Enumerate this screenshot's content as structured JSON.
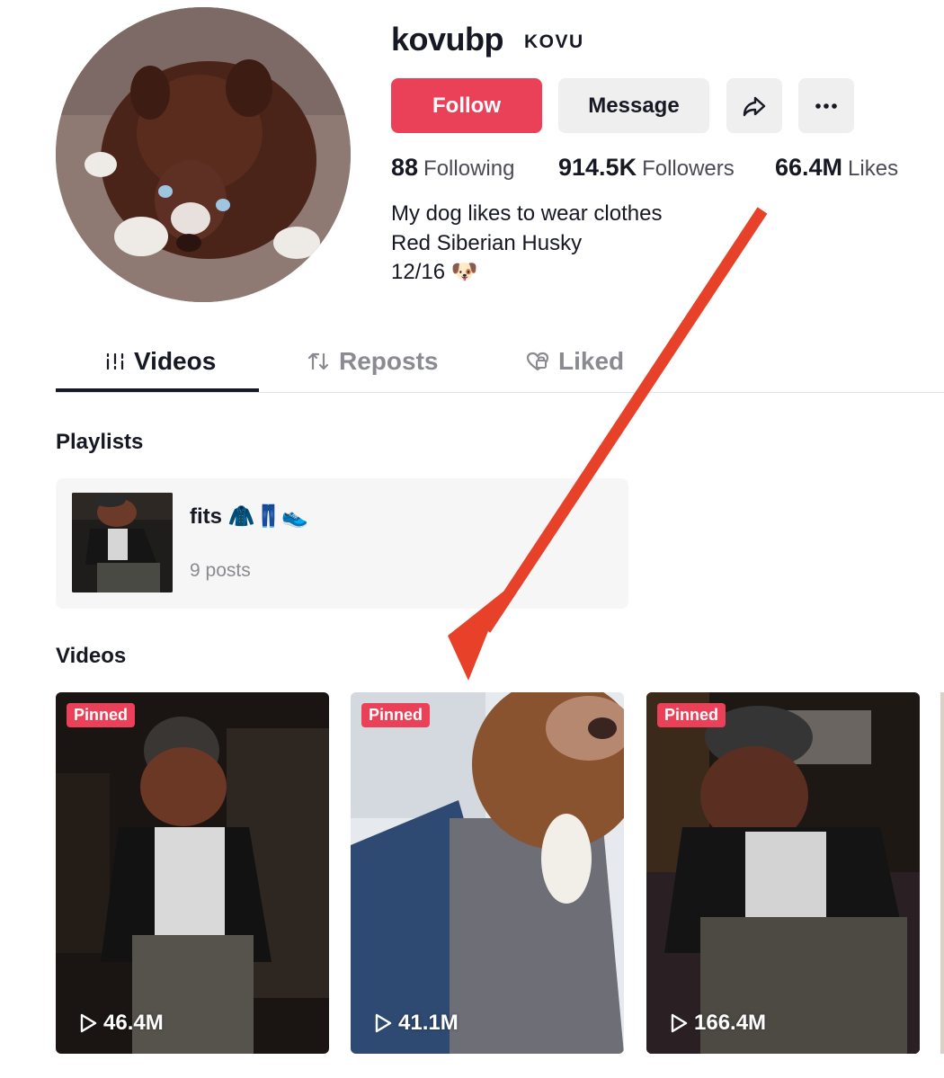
{
  "profile": {
    "username": "kovubp",
    "nickname": "KOVU",
    "follow_label": "Follow",
    "message_label": "Message",
    "share_icon": "share-icon",
    "more_icon": "more-icon",
    "stats": {
      "following_count": "88",
      "following_label": "Following",
      "followers_count": "914.5K",
      "followers_label": "Followers",
      "likes_count": "66.4M",
      "likes_label": "Likes"
    },
    "bio": {
      "line1": "My dog likes to wear clothes",
      "line2": "Red Siberian Husky",
      "line3": "12/16 🐶"
    }
  },
  "tabs": [
    {
      "label": "Videos",
      "icon": "grid-icon",
      "active": true
    },
    {
      "label": "Reposts",
      "icon": "repost-icon",
      "active": false
    },
    {
      "label": "Liked",
      "icon": "heart-lock-icon",
      "active": false
    }
  ],
  "playlists": {
    "title": "Playlists",
    "items": [
      {
        "name": "fits 🧥👖👟",
        "count": "9 posts"
      }
    ]
  },
  "videos": {
    "title": "Videos",
    "items": [
      {
        "badge": "Pinned",
        "views": "46.4M"
      },
      {
        "badge": "Pinned",
        "views": "41.1M"
      },
      {
        "badge": "Pinned",
        "views": "166.4M"
      }
    ]
  },
  "colors": {
    "accent": "#ea4159",
    "annotation_arrow": "#e8412a"
  }
}
